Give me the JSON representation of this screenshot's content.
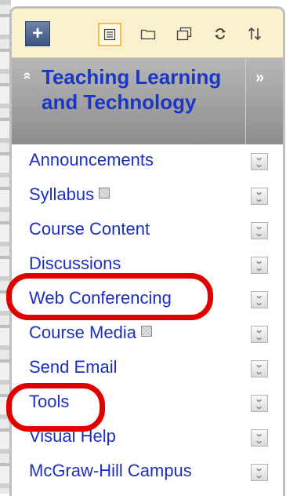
{
  "toolbar": {
    "add_icon": "+",
    "icons": [
      "plus-icon",
      "list-view-icon",
      "folder-icon",
      "window-icon",
      "refresh-icon",
      "sort-icon"
    ]
  },
  "header": {
    "title": "Teaching Learning and Technology",
    "collapse_icon": "»",
    "up_icon": "»"
  },
  "menu": {
    "items": [
      {
        "label": "Announcements",
        "hidden": false
      },
      {
        "label": "Syllabus",
        "hidden": true
      },
      {
        "label": "Course Content",
        "hidden": false
      },
      {
        "label": "Discussions",
        "hidden": false
      },
      {
        "label": "Web Conferencing",
        "hidden": false,
        "highlighted": true
      },
      {
        "label": "Course Media",
        "hidden": true
      },
      {
        "label": "Send Email",
        "hidden": false
      },
      {
        "label": "Tools",
        "hidden": false,
        "highlighted": true
      },
      {
        "label": "Visual Help",
        "hidden": false
      },
      {
        "label": "McGraw-Hill Campus",
        "hidden": false
      }
    ]
  },
  "colors": {
    "link": "#1c2fc2",
    "title": "#1b36c4",
    "toolbar_bg": "#fbf1cc",
    "header_bg": "#9f9f9f",
    "highlight": "#e00000"
  }
}
